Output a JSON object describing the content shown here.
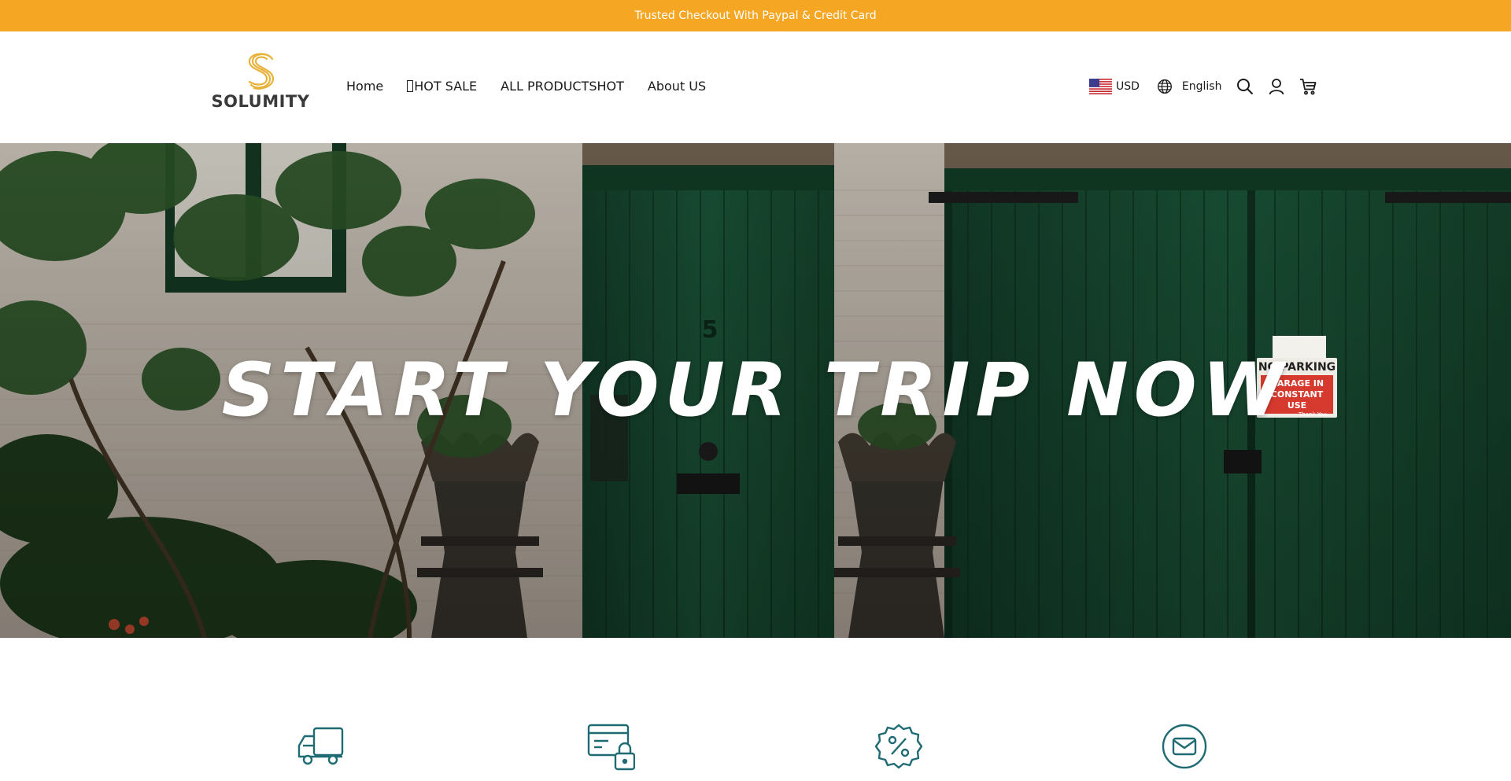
{
  "announcement": {
    "text": "Trusted Checkout With Paypal & Credit Card"
  },
  "brand": {
    "name": "SOLUMITY",
    "accent": "#f5a623",
    "logo_gold": "#e8b23a"
  },
  "nav": {
    "items": [
      {
        "label": "Home"
      },
      {
        "label": "HOT SALE",
        "prefix_glyph": "missing-glyph-box"
      },
      {
        "label": "ALL PRODUCTSHOT"
      },
      {
        "label": "About US"
      }
    ]
  },
  "utils": {
    "currency": {
      "code": "USD",
      "flag_icon": "us-flag-icon"
    },
    "language": {
      "label": "English",
      "icon": "globe-icon"
    },
    "icons": [
      "search-icon",
      "user-icon",
      "cart-icon"
    ]
  },
  "hero": {
    "title": "START YOUR TRIP NOW",
    "door_number": "5",
    "sign": {
      "line1": "NO PARKING",
      "line2": "GARAGE IN",
      "line3": "CONSTANT USE",
      "line4": "Thank You."
    }
  },
  "features": {
    "icon_color": "#1f6b73",
    "icons": [
      "delivery-truck-icon",
      "secure-payment-icon",
      "discount-badge-icon",
      "email-icon"
    ]
  }
}
